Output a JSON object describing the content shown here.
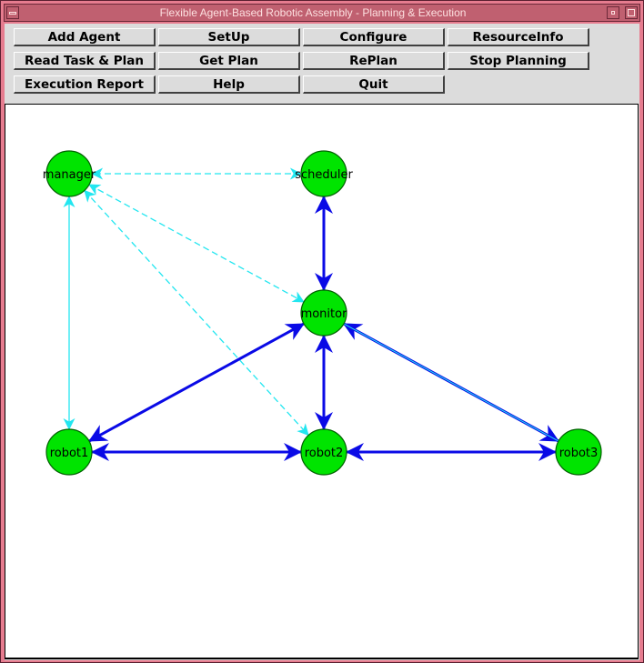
{
  "window": {
    "title": "Flexible Agent-Based Robotic Assembly - Planning & Execution"
  },
  "toolbar": {
    "buttons": [
      {
        "id": "add-agent",
        "label": "Add Agent",
        "row": 0,
        "col": 0
      },
      {
        "id": "setup",
        "label": "SetUp",
        "row": 0,
        "col": 1
      },
      {
        "id": "configure",
        "label": "Configure",
        "row": 0,
        "col": 2
      },
      {
        "id": "resource-info",
        "label": "ResourceInfo",
        "row": 0,
        "col": 3
      },
      {
        "id": "read-task-plan",
        "label": "Read Task & Plan",
        "row": 1,
        "col": 0
      },
      {
        "id": "get-plan",
        "label": "Get Plan",
        "row": 1,
        "col": 1
      },
      {
        "id": "replan",
        "label": "RePlan",
        "row": 1,
        "col": 2
      },
      {
        "id": "stop-planning",
        "label": "Stop Planning",
        "row": 1,
        "col": 3
      },
      {
        "id": "execution-report",
        "label": "Execution Report",
        "row": 2,
        "col": 0
      },
      {
        "id": "help",
        "label": "Help",
        "row": 2,
        "col": 1
      },
      {
        "id": "quit",
        "label": "Quit",
        "row": 2,
        "col": 2
      }
    ]
  },
  "graph": {
    "colors": {
      "node_fill": "#00e400",
      "node_stroke": "#006000",
      "strong_edge": "#0a0ae6",
      "weak_edge": "#22e6f0"
    },
    "nodes": [
      {
        "id": "manager",
        "label": "manager"
      },
      {
        "id": "scheduler",
        "label": "scheduler"
      },
      {
        "id": "monitor",
        "label": "monitor"
      },
      {
        "id": "robot1",
        "label": "robot1"
      },
      {
        "id": "robot2",
        "label": "robot2"
      },
      {
        "id": "robot3",
        "label": "robot3"
      }
    ],
    "edges": [
      {
        "from": "scheduler",
        "to": "manager",
        "kind": "weak",
        "dashed": true,
        "bidirectional": true
      },
      {
        "from": "manager",
        "to": "monitor",
        "kind": "weak",
        "dashed": true,
        "bidirectional": true
      },
      {
        "from": "manager",
        "to": "robot2",
        "kind": "weak",
        "dashed": true,
        "bidirectional": true
      },
      {
        "from": "manager",
        "to": "robot1",
        "kind": "weak",
        "dashed": false,
        "bidirectional": true
      },
      {
        "from": "monitor",
        "to": "robot3",
        "kind": "weak",
        "dashed": false,
        "bidirectional": true
      },
      {
        "from": "scheduler",
        "to": "monitor",
        "kind": "strong",
        "bidirectional": true
      },
      {
        "from": "monitor",
        "to": "robot1",
        "kind": "strong",
        "bidirectional": true
      },
      {
        "from": "monitor",
        "to": "robot2",
        "kind": "strong",
        "bidirectional": true
      },
      {
        "from": "monitor",
        "to": "robot3",
        "kind": "strong",
        "bidirectional": true
      },
      {
        "from": "robot1",
        "to": "robot2",
        "kind": "strong",
        "bidirectional": true
      },
      {
        "from": "robot2",
        "to": "robot3",
        "kind": "strong",
        "bidirectional": true
      }
    ]
  }
}
